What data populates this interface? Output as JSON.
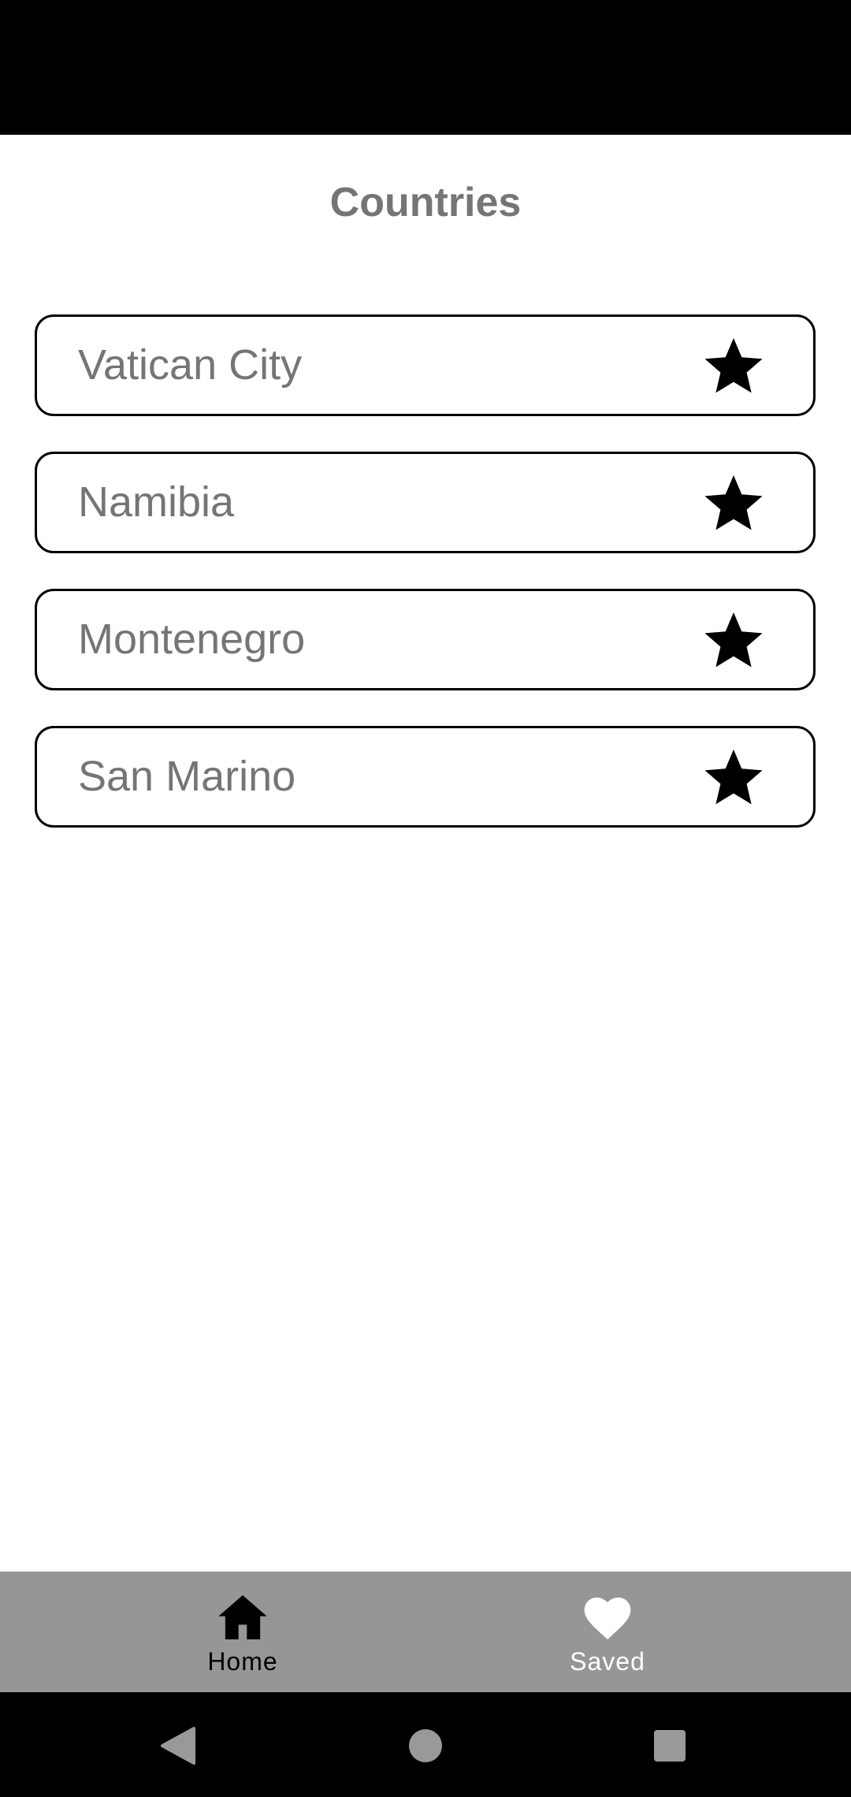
{
  "page": {
    "title": "Countries"
  },
  "countries": [
    {
      "name": "Vatican City",
      "icon": "star-icon"
    },
    {
      "name": "Namibia",
      "icon": "star-icon"
    },
    {
      "name": "Montenegro",
      "icon": "star-icon"
    },
    {
      "name": "San Marino",
      "icon": "star-icon"
    }
  ],
  "bottom_nav": {
    "home_label": "Home",
    "home_icon": "home-icon",
    "saved_label": "Saved",
    "saved_icon": "heart-icon"
  },
  "system_nav": {
    "back_icon": "back-triangle-icon",
    "home_icon": "home-circle-icon",
    "recents_icon": "recents-square-icon"
  },
  "colors": {
    "background": "#ffffff",
    "text_gray": "#757575",
    "nav_bar": "#969696",
    "border": "#000000"
  }
}
